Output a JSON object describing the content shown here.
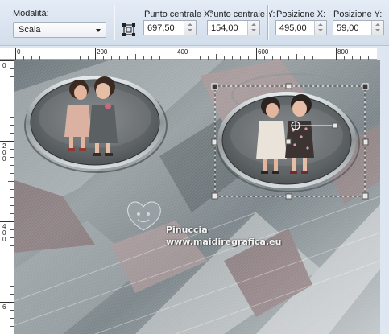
{
  "toolbar": {
    "mode": {
      "label": "Modalità:",
      "value": "Scala"
    },
    "center_x": {
      "label": "Punto centrale X:",
      "value": "697,50"
    },
    "center_y": {
      "label": "Punto centrale Y:",
      "value": "154,00"
    },
    "pos_x": {
      "label": "Posizione X:",
      "value": "495,00"
    },
    "pos_y": {
      "label": "Posizione Y:",
      "value": "59,00"
    }
  },
  "ruler": {
    "h_labels": [
      "0",
      "200",
      "400",
      "600",
      "800"
    ],
    "v_labels": [
      "0",
      "2 0 0",
      "4 0 0",
      "6"
    ]
  },
  "watermark": {
    "name": "Pinuccia",
    "site": "www.maidiregrafica.eu"
  },
  "colors": {
    "toolbar_bg": "#dde6f1",
    "canvas_gray": "#8d969a",
    "rose_accent": "#9a6a6c"
  }
}
